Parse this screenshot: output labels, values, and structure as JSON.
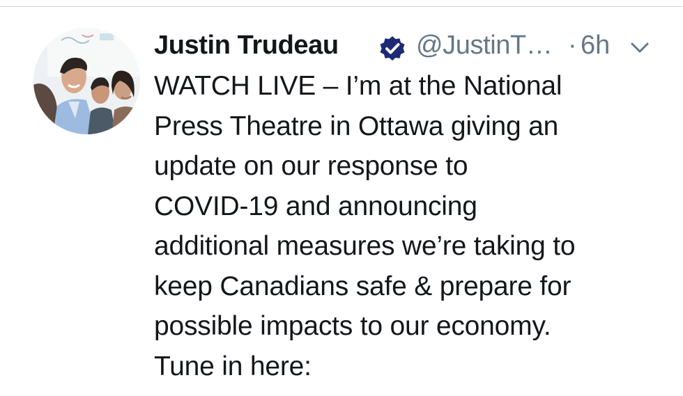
{
  "tweet": {
    "author": {
      "display_name": "Justin Trudeau",
      "handle": "@JustinT…",
      "verified": true,
      "avatar_icon": "profile-photo"
    },
    "separator": "·",
    "timestamp": "6h",
    "menu_icon": "chevron-down-icon",
    "text_lines": [
      "WATCH LIVE – I’m at the National",
      "Press Theatre in Ottawa giving an",
      "update on our response to",
      "COVID-19 and announcing",
      "additional measures we’re taking to",
      "keep Canadians safe & prepare for",
      "possible impacts to our economy.",
      "Tune in here:"
    ]
  },
  "colors": {
    "text_primary": "#14171a",
    "text_secondary": "#657786",
    "verified_blue": "#1d2a73",
    "divider": "#cfd6dc"
  }
}
